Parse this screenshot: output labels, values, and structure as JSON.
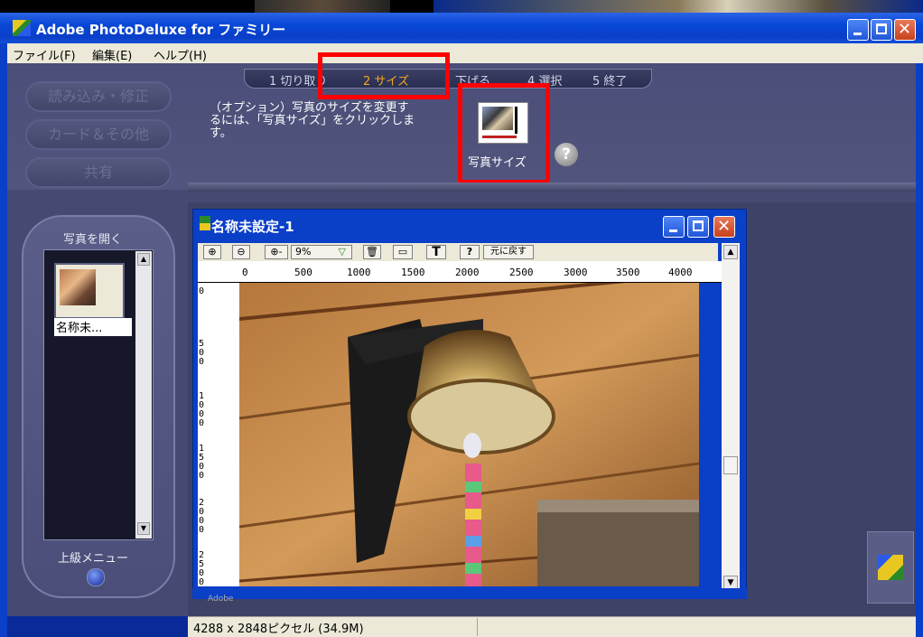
{
  "window": {
    "title": "Adobe PhotoDeluxe for ファミリー"
  },
  "menu": [
    "ファイル(F)",
    "編集(E)",
    "ヘルプ(H)"
  ],
  "side_tabs": [
    "読み込み・修正",
    "カード＆その他",
    "共有"
  ],
  "steps": [
    "1 切り取り",
    "2 サイズ",
    "下げる",
    "4 選択",
    "5 終了"
  ],
  "active_step": 1,
  "description": "（オプション）写真のサイズを変更するには、「写真サイズ」をクリックします。",
  "size_button": {
    "label": "写真サイズ"
  },
  "help": {
    "glyph": "?"
  },
  "open_panel": {
    "title": "写真を開く",
    "thumb_label": "名称未...",
    "advanced_menu": "上級メニュー"
  },
  "document": {
    "title": "名称未設定-1",
    "toolbar": {
      "zoom": "9%",
      "undo_label": "元に戻す",
      "text_tool": "T",
      "help_tool": "?"
    },
    "ruler_h": [
      "0",
      "500",
      "1000",
      "1500",
      "2000",
      "2500",
      "3000",
      "3500",
      "4000"
    ],
    "ruler_v": [
      "0",
      "500",
      "1000",
      "1500",
      "2000",
      "2500"
    ],
    "adobe_tag": "Adobe"
  },
  "status": {
    "text": "4288 x 2848ピクセル (34.9M)"
  },
  "colors": {
    "xp_blue": "#0a3fc8",
    "panel": "#464a72",
    "highlight": "#ff0000",
    "active_step": "#f0a820"
  }
}
